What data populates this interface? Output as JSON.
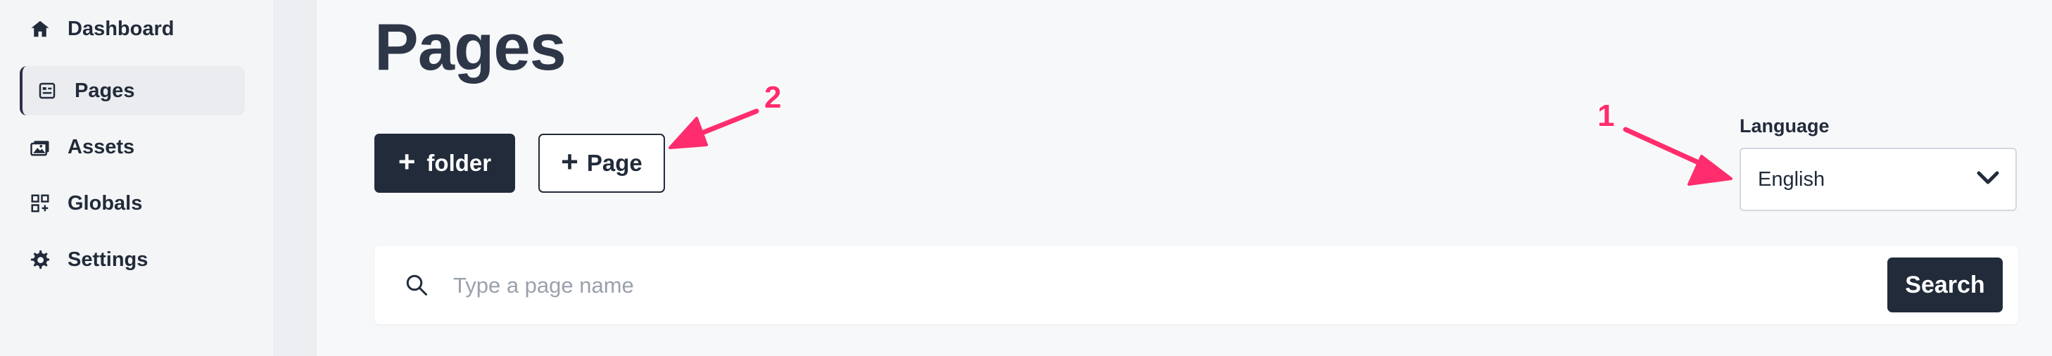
{
  "sidebar": {
    "items": [
      {
        "label": "Dashboard",
        "icon": "home-icon"
      },
      {
        "label": "Pages",
        "icon": "page-icon",
        "active": true
      },
      {
        "label": "Assets",
        "icon": "images-icon"
      },
      {
        "label": "Globals",
        "icon": "globals-icon"
      },
      {
        "label": "Settings",
        "icon": "gear-icon"
      }
    ]
  },
  "main": {
    "title": "Pages",
    "buttons": {
      "folder_label": "folder",
      "page_label": "Page"
    },
    "language": {
      "label": "Language",
      "selected": "English"
    },
    "search": {
      "placeholder": "Type a page name",
      "button_label": "Search"
    }
  },
  "annotations": {
    "marker_1": "1",
    "marker_2": "2",
    "color": "#ff2d6d"
  },
  "colors": {
    "primary_dark": "#222b3a",
    "background": "#f7f8fa"
  }
}
